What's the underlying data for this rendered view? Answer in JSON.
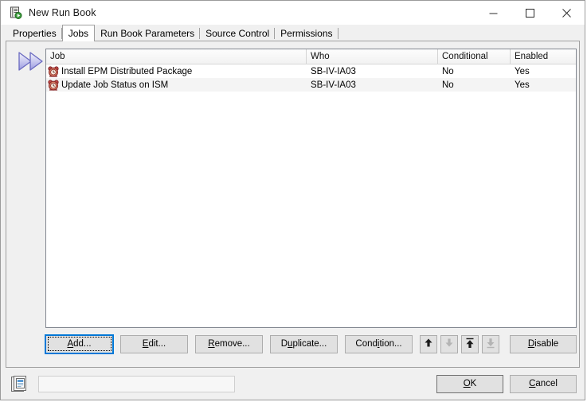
{
  "window": {
    "title": "New Run Book",
    "icon": "runbook-icon",
    "controls": {
      "minimize": "minimize-icon",
      "maximize": "maximize-icon",
      "close": "close-icon"
    }
  },
  "tabs": [
    {
      "label": "Properties",
      "selected": false
    },
    {
      "label": "Jobs",
      "selected": true
    },
    {
      "label": "Run Book Parameters",
      "selected": false
    },
    {
      "label": "Source Control",
      "selected": false
    },
    {
      "label": "Permissions",
      "selected": false
    }
  ],
  "run_indicator": {
    "icon": "double-arrow-right-icon"
  },
  "job_list": {
    "columns": [
      "Job",
      "Who",
      "Conditional",
      "Enabled"
    ],
    "rows": [
      {
        "icon": "alarm-clock-icon",
        "job": "Install EPM Distributed Package",
        "who": "SB-IV-IA03",
        "conditional": "No",
        "enabled": "Yes"
      },
      {
        "icon": "alarm-clock-icon",
        "job": "Update Job Status on ISM",
        "who": "SB-IV-IA03",
        "conditional": "No",
        "enabled": "Yes"
      }
    ]
  },
  "buttons": {
    "add": {
      "label": "Add...",
      "accel": "A",
      "focused": true
    },
    "edit": {
      "label": "Edit...",
      "accel": "E"
    },
    "remove": {
      "label": "Remove...",
      "accel": "R"
    },
    "duplicate": {
      "label": "Duplicate...",
      "accel": "p"
    },
    "condition": {
      "label": "Condition...",
      "accel": "i"
    },
    "move_up": {
      "icon": "arrow-up-icon",
      "enabled": true
    },
    "move_down": {
      "icon": "arrow-down-icon",
      "enabled": false
    },
    "move_top": {
      "icon": "arrow-up-to-top-icon",
      "enabled": true
    },
    "move_bottom": {
      "icon": "arrow-down-to-bottom-icon",
      "enabled": false
    },
    "disable": {
      "label": "Disable",
      "accel": "D"
    }
  },
  "footer": {
    "icon": "stacked-windows-icon",
    "status_text": "",
    "ok": {
      "label": "OK",
      "accel": "O"
    },
    "cancel": {
      "label": "Cancel",
      "accel": "C"
    }
  },
  "colors": {
    "window_bg": "#f0f0f0",
    "titlebar_bg": "#ffffff",
    "list_bg": "#ffffff",
    "list_alt_row": "#f4f4f4",
    "button_face": "#e1e1e1",
    "focus_blue": "#0078d7",
    "accent_arrow": "#7b7bd0",
    "clock_red": "#b03030"
  }
}
